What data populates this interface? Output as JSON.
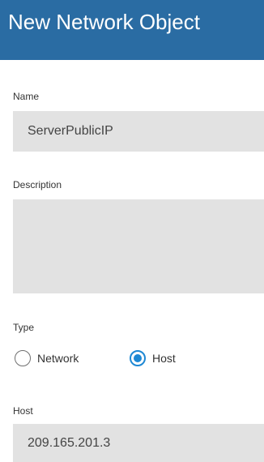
{
  "dialog": {
    "title": "New Network Object"
  },
  "form": {
    "name_label": "Name",
    "name_value": "ServerPublicIP",
    "description_label": "Description",
    "description_value": "",
    "type_label": "Type",
    "type_options": [
      {
        "label": "Network",
        "selected": false
      },
      {
        "label": "Host",
        "selected": true
      }
    ],
    "host_label": "Host",
    "host_value": "209.165.201.3"
  },
  "colors": {
    "header_bg": "#2a6ca3",
    "field_bg": "#e2e2e2",
    "accent": "#1e88d4"
  }
}
